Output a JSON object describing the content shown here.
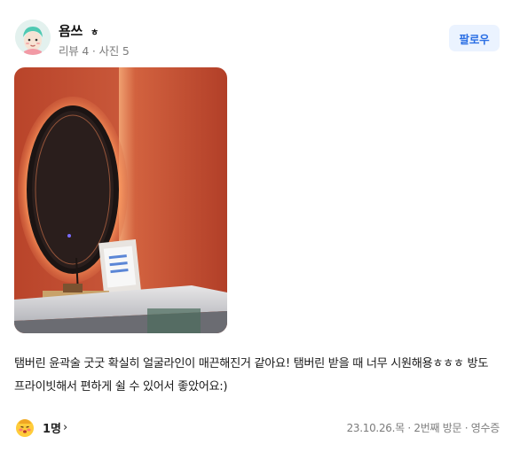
{
  "user": {
    "name": "욤쓰",
    "name_suffix": "ㅎ",
    "meta": "리뷰 4 · 사진 5",
    "follow_label": "팔로우",
    "avatar_icon": "face-avatar-icon"
  },
  "photo": {
    "alt": "review-photo",
    "wall_color": "#c3502f",
    "mirror_color": "#1b1413"
  },
  "review": {
    "text": "탬버린 윤곽술 굿굿 확실히 얼굴라인이 매끈해진거 같아요! 탬버린 받을 때 너무 시원해용ㅎㅎㅎ 방도 프라이빗해서 편하게 쉴 수 있어서 좋았어요:)"
  },
  "footer": {
    "reaction_icon": "blush-face-icon",
    "reaction_count": "1명",
    "chevron": "›",
    "info": "23.10.26.목 · 2번째 방문 · 영수증"
  },
  "colors": {
    "accent": "#2b6fe4",
    "accent_bg": "#ebf3ff",
    "meta_gray": "#7c7c7c"
  }
}
